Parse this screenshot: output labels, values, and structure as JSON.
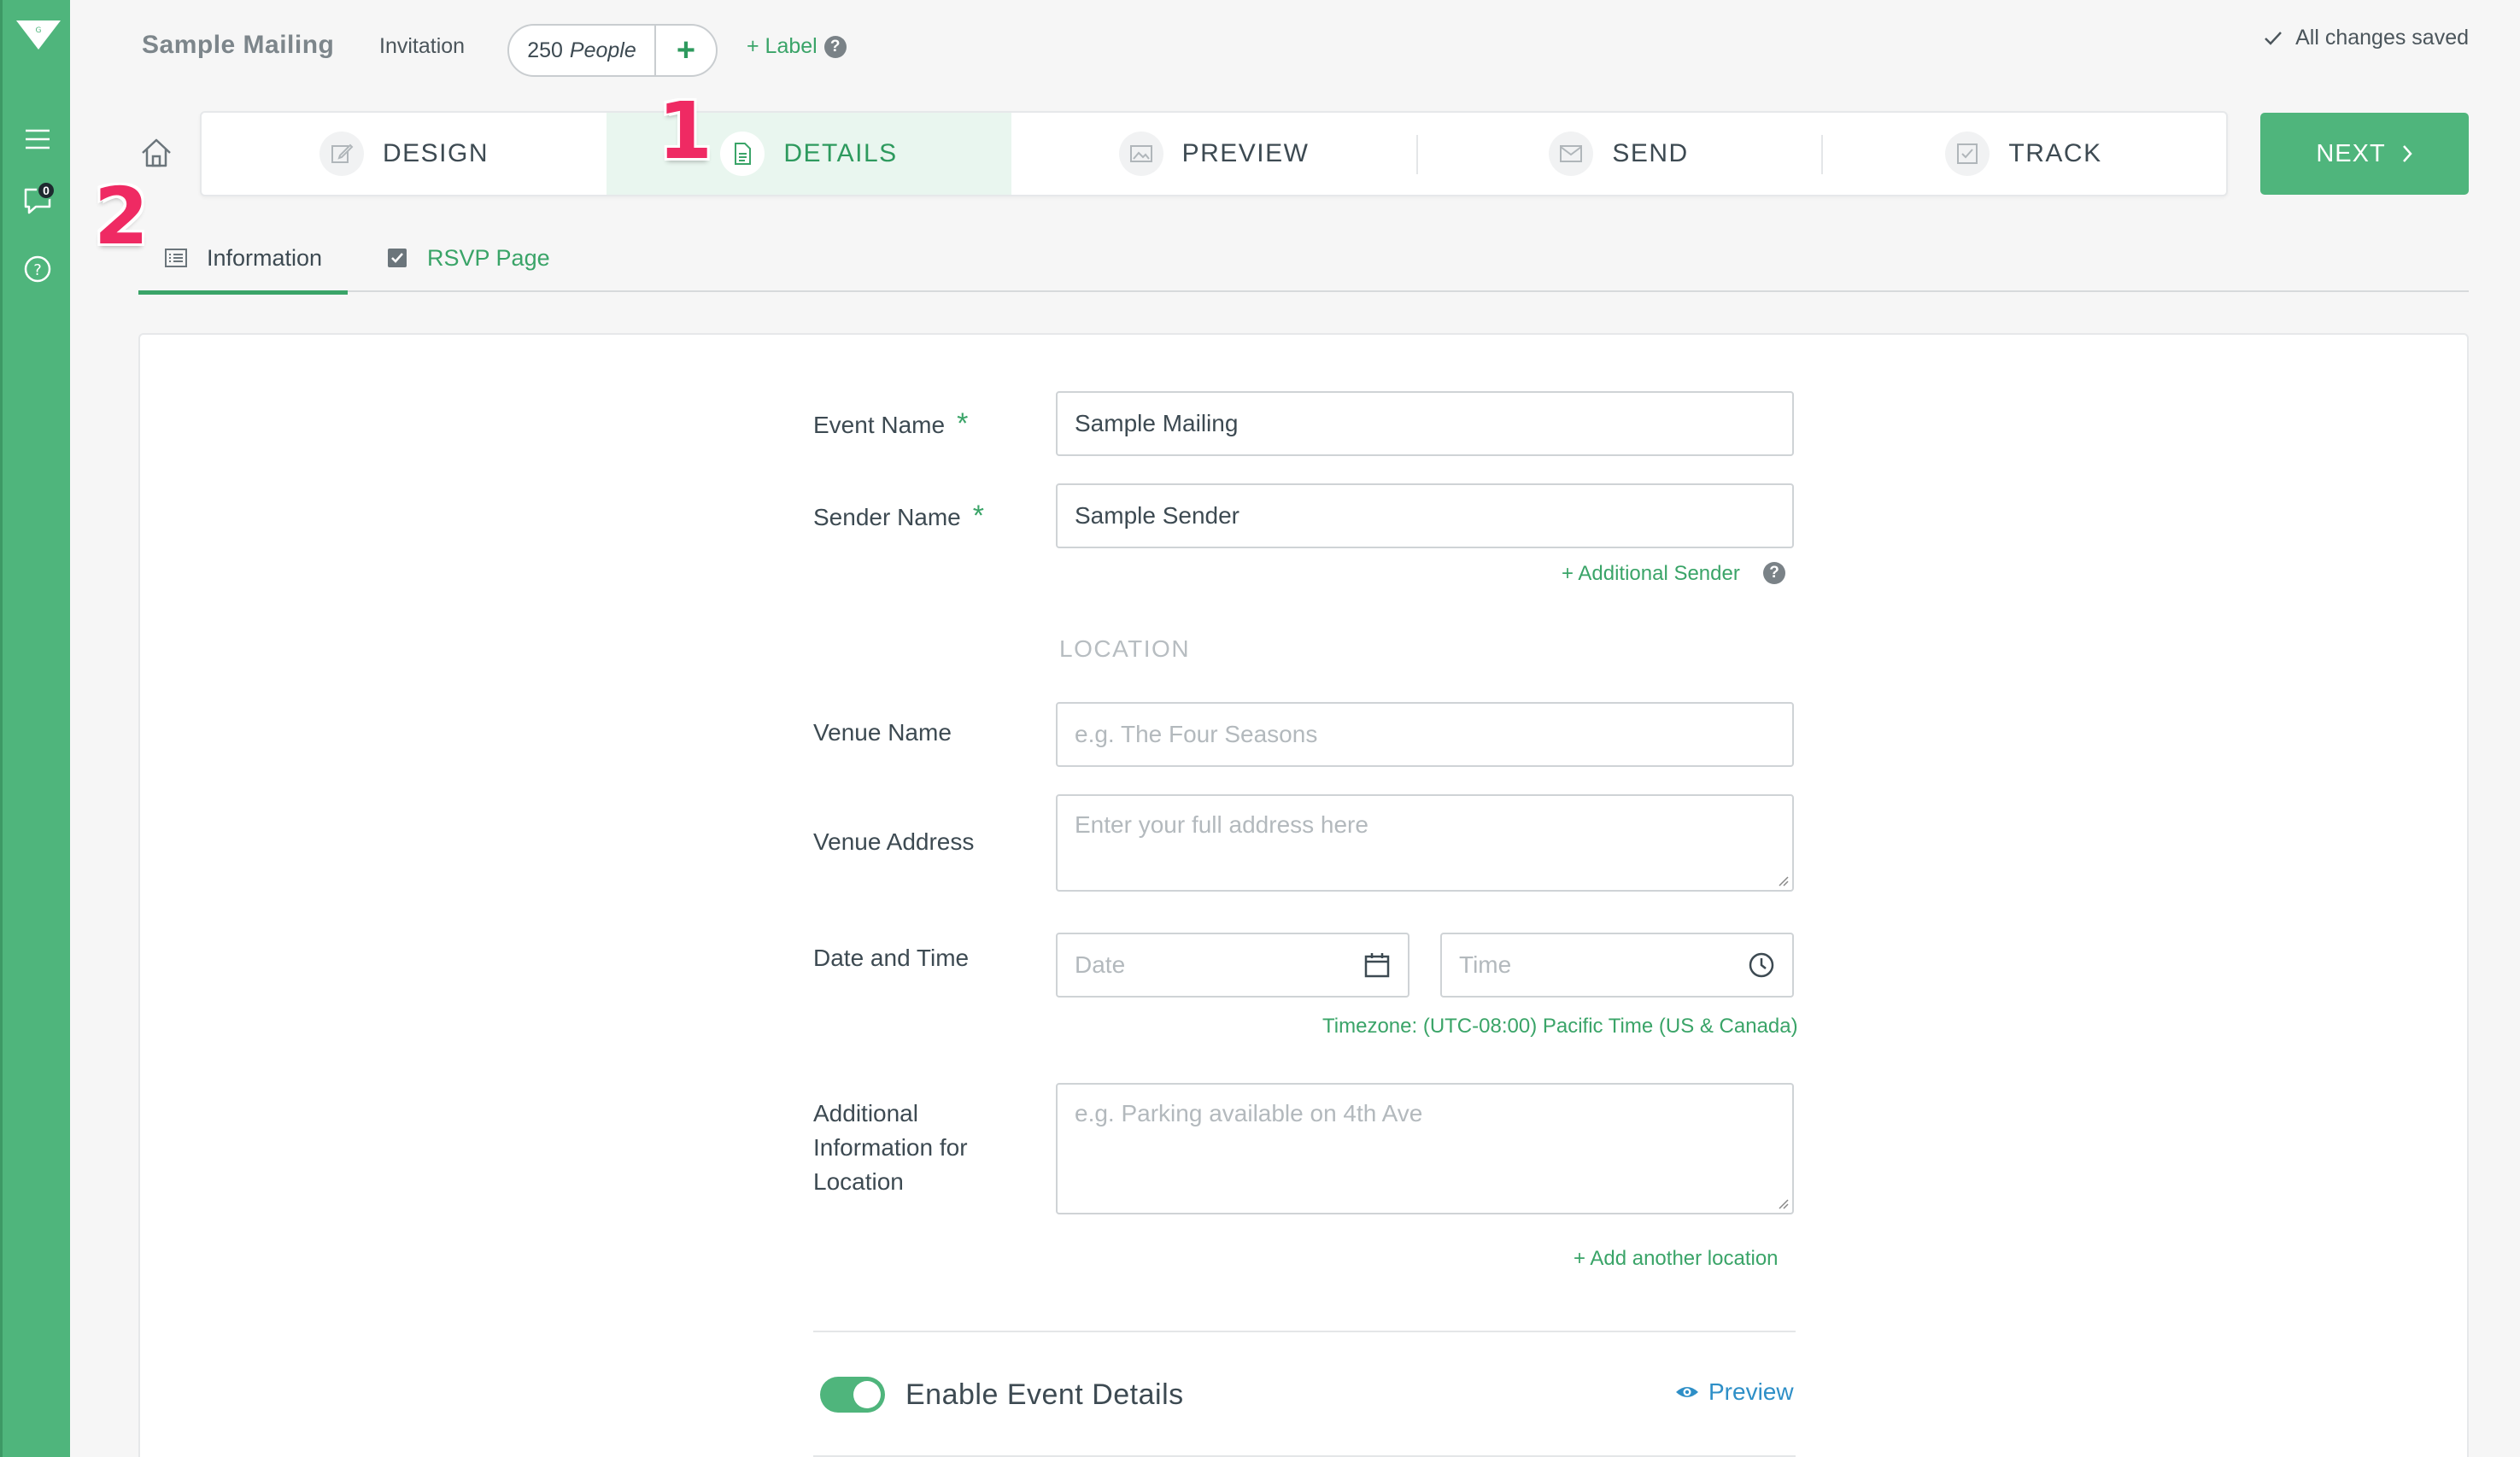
{
  "header": {
    "doc_title": "Sample Mailing",
    "doc_type": "Invitation",
    "people_count": "250",
    "people_unit": "People",
    "label_link": "+ Label",
    "save_status": "All changes saved"
  },
  "sidebar": {
    "chat_badge": "0",
    "icons": [
      "menu-icon",
      "chat-icon",
      "help-icon"
    ]
  },
  "steps": [
    {
      "label": "DESIGN",
      "icon": "pencil-icon",
      "active": false
    },
    {
      "label": "DETAILS",
      "icon": "document-icon",
      "active": true
    },
    {
      "label": "PREVIEW",
      "icon": "image-icon",
      "active": false
    },
    {
      "label": "SEND",
      "icon": "envelope-icon",
      "active": false
    },
    {
      "label": "TRACK",
      "icon": "checkbox-icon",
      "active": false
    }
  ],
  "next_button": "NEXT",
  "annotations": {
    "one": "1",
    "two": "2"
  },
  "subtabs": {
    "information": "Information",
    "rsvp": "RSVP Page"
  },
  "form": {
    "event_name_label": "Event Name",
    "event_name_value": "Sample Mailing",
    "sender_name_label": "Sender Name",
    "sender_name_value": "Sample Sender",
    "required_mark": "*",
    "additional_sender": "+ Additional Sender",
    "location_heading": "LOCATION",
    "venue_name_label": "Venue Name",
    "venue_name_placeholder": "e.g. The Four Seasons",
    "venue_address_label": "Venue Address",
    "venue_address_placeholder": "Enter your full address here",
    "date_time_label": "Date and Time",
    "date_placeholder": "Date",
    "time_placeholder": "Time",
    "timezone": "Timezone: (UTC-08:00) Pacific Time (US & Canada)",
    "additional_info_label_1": "Additional",
    "additional_info_label_2": "Information for",
    "additional_info_label_3": "Location",
    "additional_info_placeholder": "e.g. Parking available on 4th Ave",
    "add_location": "+ Add another location",
    "enable_event_details": "Enable Event Details",
    "enable_event_details_on": true,
    "preview_link": "Preview"
  },
  "colors": {
    "brand_green": "#4fb57c",
    "link_green": "#3aa468",
    "annotation_pink": "#ef2a63",
    "preview_blue": "#2e8fc7"
  }
}
